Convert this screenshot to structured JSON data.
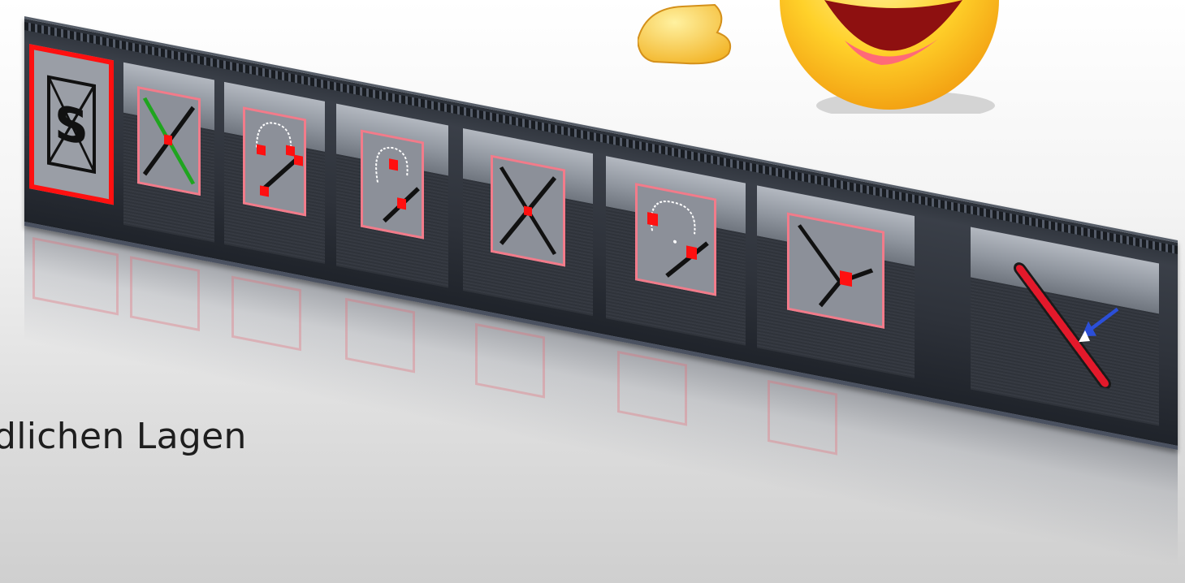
{
  "caption": {
    "text": "dlichen Lagen"
  },
  "toolbar": {
    "buttons": [
      {
        "id": "snap-off",
        "icon": "snap-s-icon",
        "active": true
      },
      {
        "id": "snap-intersect-green",
        "icon": "cross-green-icon",
        "active": false
      },
      {
        "id": "snap-arc-endpoints",
        "icon": "arc-endpoints-icon",
        "active": false
      },
      {
        "id": "snap-arc-midpoint",
        "icon": "arc-midpoint-icon",
        "active": false
      },
      {
        "id": "snap-intersection",
        "icon": "intersection-x-icon",
        "active": false
      },
      {
        "id": "snap-arc-center",
        "icon": "arc-center-icon",
        "active": false
      },
      {
        "id": "snap-line-midpoint",
        "icon": "line-midpoint-icon",
        "active": false
      },
      {
        "id": "snap-to-element",
        "icon": "ruler-arrow-icon",
        "active": false
      }
    ]
  },
  "decoration": {
    "emoji": "smiley-thumbs-up-icon"
  },
  "colors": {
    "accent_red": "#ff1010",
    "frame_pink": "#f27b8a",
    "toolbar_dark": "#2e323a",
    "line_green": "#1fa51f",
    "arrow_blue": "#2b4fd8"
  }
}
